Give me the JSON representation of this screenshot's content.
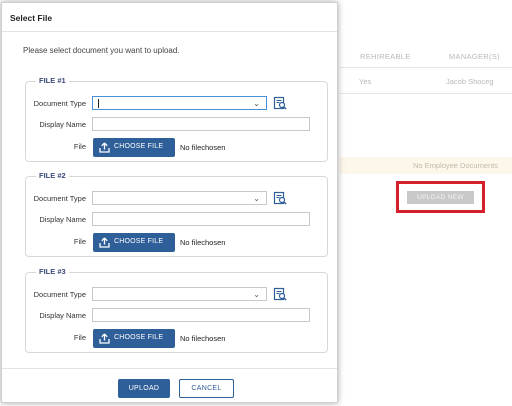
{
  "background": {
    "columns": [
      "REHIREABLE",
      "MANAGER(S)"
    ],
    "row": {
      "rehireable": "Yes",
      "manager": "Jacob Shoceg"
    },
    "empty_message": "No Employee Documents",
    "upload_new_label": "UPLOAD NEW",
    "highlight_color": "#d4202a"
  },
  "modal": {
    "title": "Select File",
    "intro": "Please select document you want to upload.",
    "sections": [
      {
        "legend": "FILE #1",
        "doc_type_label": "Document Type",
        "doc_type_value": "",
        "display_name_label": "Display Name",
        "display_name_value": "",
        "file_label": "File",
        "choose_label": "CHOOSE FILE",
        "no_file_text": "No filechosen"
      },
      {
        "legend": "FILE #2",
        "doc_type_label": "Document Type",
        "doc_type_value": "",
        "display_name_label": "Display Name",
        "display_name_value": "",
        "file_label": "File",
        "choose_label": "CHOOSE FILE",
        "no_file_text": "No filechosen"
      },
      {
        "legend": "FILE #3",
        "doc_type_label": "Document Type",
        "doc_type_value": "",
        "display_name_label": "Display Name",
        "display_name_value": "",
        "file_label": "File",
        "choose_label": "CHOOSE FILE",
        "no_file_text": "No filechosen"
      }
    ],
    "upload_label": "UPLOAD",
    "cancel_label": "CANCEL",
    "accent_color": "#2f5f98"
  },
  "icons": {
    "chevron": "chevron-down-icon",
    "lookup": "document-search-icon",
    "upload": "upload-icon"
  }
}
